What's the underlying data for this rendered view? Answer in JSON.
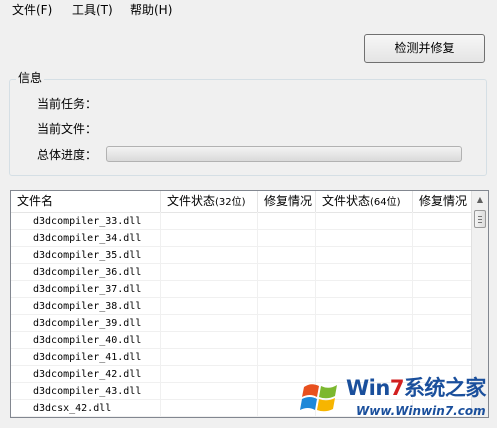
{
  "menu": {
    "file": "文件(F)",
    "tools": "工具(T)",
    "help": "帮助(H)"
  },
  "actions": {
    "repair_button": "检测并修复"
  },
  "info": {
    "group_title": "信息",
    "current_task_label": "当前任务：",
    "current_file_label": "当前文件：",
    "overall_progress_label": "总体进度：",
    "overall_progress_value": 0
  },
  "file_list": {
    "columns": {
      "file_name": "文件名",
      "status32_prefix": "文件状态",
      "status32_suffix": "(32位)",
      "repair32": "修复情况",
      "status64_prefix": "文件状态",
      "status64_suffix": "(64位)",
      "repair64": "修复情况"
    },
    "rows": [
      "d3dcompiler_33.dll",
      "d3dcompiler_34.dll",
      "d3dcompiler_35.dll",
      "d3dcompiler_36.dll",
      "d3dcompiler_37.dll",
      "d3dcompiler_38.dll",
      "d3dcompiler_39.dll",
      "d3dcompiler_40.dll",
      "d3dcompiler_41.dll",
      "d3dcompiler_42.dll",
      "d3dcompiler_43.dll",
      "d3dcsx_42.dll"
    ]
  },
  "watermark": {
    "brand_prefix": "Win",
    "brand_seven": "7",
    "brand_suffix": "系统之家",
    "url": "Www.Winwin7.com"
  }
}
